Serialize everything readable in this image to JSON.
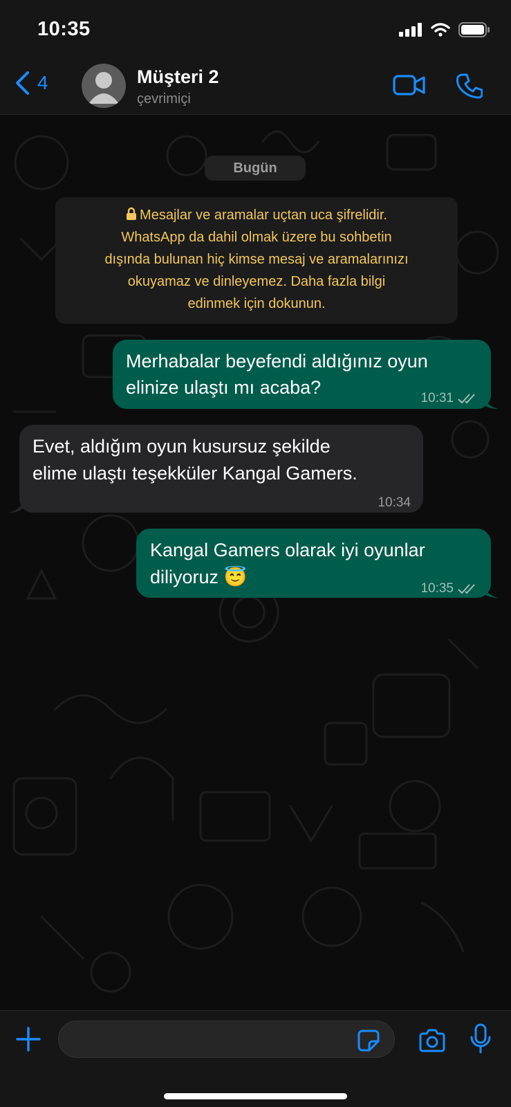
{
  "status_bar": {
    "time": "10:35"
  },
  "header": {
    "back_count": "4",
    "contact_name": "Müşteri 2",
    "contact_status": "çevrimiçi"
  },
  "chat": {
    "date_label": "Bugün",
    "encryption_notice": [
      "Mesajlar ve aramalar uçtan uca şifrelidir.",
      "WhatsApp da dahil olmak üzere bu sohbetin",
      "dışında bulunan hiç kimse mesaj ve aramalarınızı",
      "okuyamaz ve dinleyemez. Daha fazla bilgi",
      "edinmek için dokunun."
    ],
    "messages": [
      {
        "direction": "outgoing",
        "lines": [
          "Merhabalar beyefendi aldığınız oyun",
          "elinize ulaştı mı acaba?"
        ],
        "time": "10:31",
        "status": "read"
      },
      {
        "direction": "incoming",
        "lines": [
          "Evet, aldığım oyun kusursuz şekilde",
          "elime ulaştı teşekküler Kangal Gamers."
        ],
        "time": "10:34"
      },
      {
        "direction": "outgoing",
        "lines": [
          "Kangal Gamers olarak iyi oyunlar",
          "diliyoruz 😇"
        ],
        "time": "10:35",
        "status": "read"
      }
    ]
  },
  "composer": {
    "placeholder": ""
  },
  "icons": {
    "back": "chevron-left-icon",
    "video": "video-call-icon",
    "phone": "phone-icon",
    "plus": "plus-icon",
    "sticker": "sticker-icon",
    "camera": "camera-icon",
    "mic": "microphone-icon"
  },
  "colors": {
    "accent": "#1a8cff",
    "outgoing_bubble": "#005c4b",
    "incoming_bubble": "#262628",
    "notice_text": "#f2c75c"
  }
}
